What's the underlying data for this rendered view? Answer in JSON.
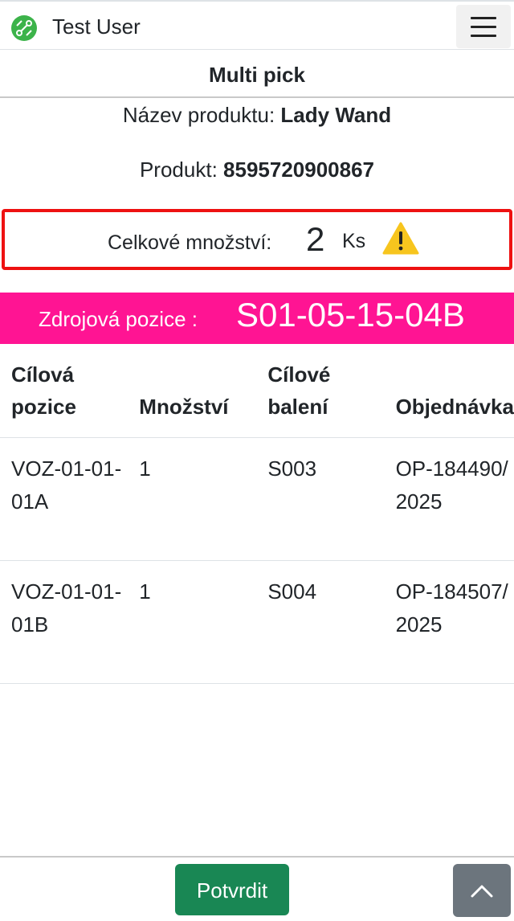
{
  "header": {
    "user_name": "Test User",
    "logo_icon": "green-circuit-logo-icon",
    "menu_icon": "hamburger-menu-icon"
  },
  "page": {
    "title": "Multi pick"
  },
  "product": {
    "name_label": "Název produktu:",
    "name_value": "Lady Wand",
    "code_label": "Produkt:",
    "code_value": "8595720900867"
  },
  "total": {
    "label": "Celkové množství:",
    "value": "2",
    "unit": "Ks",
    "warning_icon": "warning-triangle-icon",
    "border_color": "#ee1111"
  },
  "source": {
    "label": "Zdrojová pozice :",
    "value": "S01-05-15-04B",
    "bg_color": "#ff1493"
  },
  "table": {
    "headers": [
      "Cílová pozice",
      "Množství",
      "Cílové balení",
      "Objednávka"
    ],
    "rows": [
      {
        "target": "VOZ-01-01-01A",
        "qty": "1",
        "package": "S003",
        "order": "OP-184490/2025"
      },
      {
        "target": "VOZ-01-01-01B",
        "qty": "1",
        "package": "S004",
        "order": "OP-184507/2025"
      }
    ]
  },
  "footer": {
    "confirm_label": "Potvrdit",
    "confirm_color": "#198754",
    "scroll_up_icon": "chevron-up-icon"
  }
}
